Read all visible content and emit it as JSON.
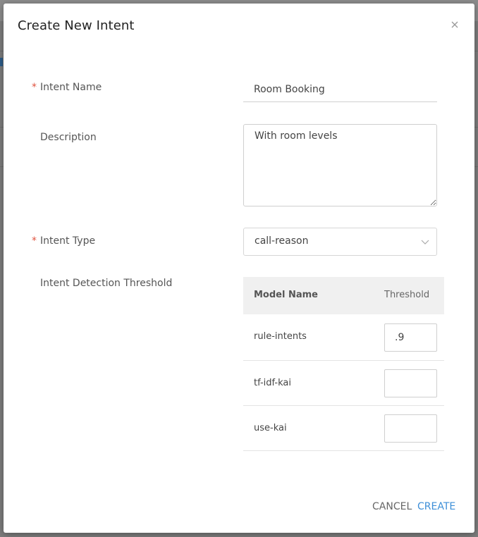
{
  "dialog": {
    "title": "Create New Intent"
  },
  "form": {
    "intent_name": {
      "label": "Intent Name",
      "value": "Room Booking",
      "required": true
    },
    "description": {
      "label": "Description",
      "value": "With room levels"
    },
    "intent_type": {
      "label": "Intent Type",
      "value": "call-reason",
      "required": true
    },
    "threshold": {
      "label": "Intent Detection Threshold",
      "columns": {
        "model": "Model Name",
        "threshold": "Threshold"
      },
      "rows": [
        {
          "model": "rule-intents",
          "threshold": ".9"
        },
        {
          "model": "tf-idf-kai",
          "threshold": ""
        },
        {
          "model": "use-kai",
          "threshold": ""
        }
      ]
    }
  },
  "actions": {
    "cancel_label": "CANCEL",
    "create_label": "CREATE"
  },
  "colors": {
    "primary": "#3d8fd8",
    "required": "#e0533f"
  },
  "icons": {
    "close": "close-icon",
    "dropdown": "chevron-down-icon"
  }
}
